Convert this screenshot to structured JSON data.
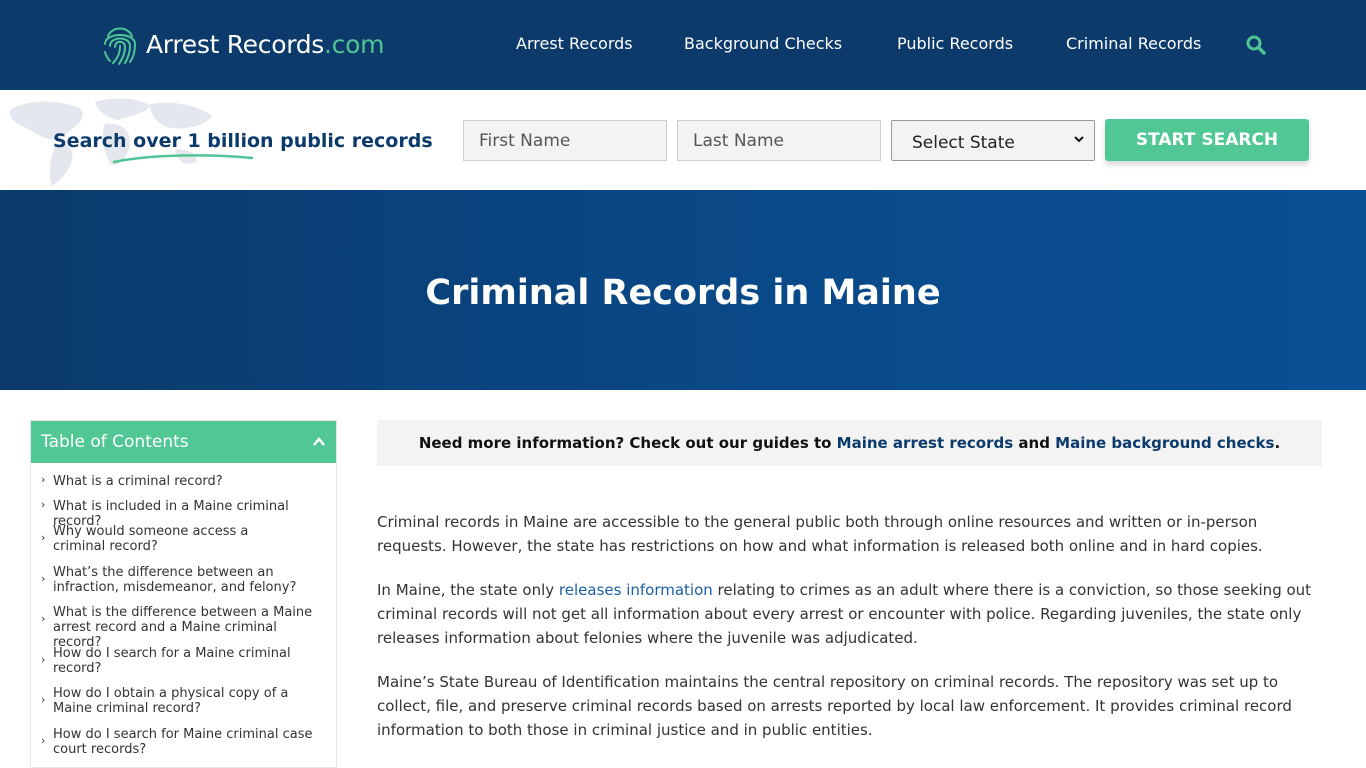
{
  "header": {
    "logo_main": "Arrest Records",
    "logo_suffix": ".com",
    "nav": [
      "Arrest Records",
      "Background Checks",
      "Public Records",
      "Criminal Records"
    ]
  },
  "search": {
    "title": "Search over 1 billion public records",
    "first_name_placeholder": "First Name",
    "last_name_placeholder": "Last Name",
    "state_selected": "Select State",
    "button_label": "START SEARCH"
  },
  "hero": {
    "title": "Criminal Records in Maine"
  },
  "toc": {
    "title": "Table of Contents",
    "items": [
      "What is a criminal record?",
      "What is included in a Maine criminal record?",
      "Why would someone access a criminal record?",
      "What’s the difference between an infraction, misdemeanor, and felony?",
      "What is the difference between a Maine arrest record and a Maine criminal record?",
      "How do I search for a Maine criminal record?",
      "How do I obtain a physical copy of a Maine criminal record?",
      "How do I search for Maine criminal case court records?"
    ]
  },
  "notice": {
    "prefix": "Need more information? Check out our guides to ",
    "link1": "Maine arrest records",
    "middle": " and ",
    "link2": "Maine background checks",
    "suffix": "."
  },
  "content": {
    "p1": "Criminal records in Maine are accessible to the general public both through online resources and written or in-person requests. However, the state has restrictions on how and what information is released both online and in hard copies.",
    "p2_before": "In Maine, the state only ",
    "p2_link": "releases information",
    "p2_after": " relating to crimes as an adult where there is a conviction, so those seeking out criminal records will not get all information about every arrest or encounter with police. Regarding juveniles, the state only releases information about felonies where the juvenile was adjudicated.",
    "p3": "Maine’s State Bureau of Identification maintains the central repository on criminal records. The repository was set up to collect, file, and preserve criminal records based on arrests reported by local law enforcement. It provides criminal record information to both those in criminal justice and in public entities."
  },
  "colors": {
    "navy": "#0b3a6b",
    "green": "#52c796",
    "link": "#1b5fa5"
  },
  "icons": [
    "fingerprint-icon",
    "search-icon",
    "world-map-icon",
    "chevron-up-icon",
    "chevron-right-icon",
    "dropdown-caret-icon"
  ]
}
